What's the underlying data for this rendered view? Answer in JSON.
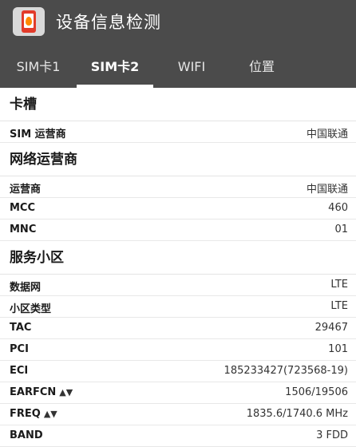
{
  "app": {
    "title": "设备信息检测",
    "icon": "phone-fire-icon"
  },
  "tabs": [
    {
      "label": "SIM卡1"
    },
    {
      "label": "SIM卡2"
    },
    {
      "label": "WIFI"
    },
    {
      "label": "位置"
    }
  ],
  "sections": {
    "slot": {
      "title": "卡槽",
      "rows": [
        {
          "label": "SIM 运营商",
          "value": "中国联通"
        }
      ]
    },
    "operator": {
      "title": "网络运营商",
      "rows": [
        {
          "label": "运营商",
          "value": "中国联通"
        },
        {
          "label": "MCC",
          "value": "460"
        },
        {
          "label": "MNC",
          "value": "01"
        }
      ]
    },
    "cell": {
      "title": "服务小区",
      "rows": [
        {
          "label": "数据网",
          "value": "LTE"
        },
        {
          "label": "小区类型",
          "value": "LTE"
        },
        {
          "label": "TAC",
          "value": "29467"
        },
        {
          "label": "PCI",
          "value": "101"
        },
        {
          "label": "ECI",
          "value": "185233427(723568-19)"
        },
        {
          "label": "EARFCN",
          "value": "1506/19506"
        },
        {
          "label": "FREQ",
          "value": "1835.6/1740.6 MHz"
        },
        {
          "label": "BAND",
          "value": "3 FDD"
        }
      ]
    }
  },
  "icons": {
    "sort": "▲▼"
  },
  "colors": {
    "appbar": "#4b4b4b",
    "accent": "#e23b2a"
  }
}
